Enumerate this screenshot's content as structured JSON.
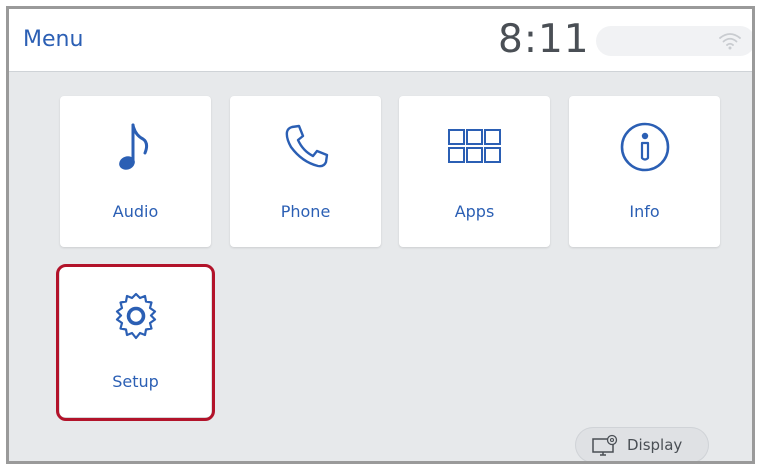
{
  "header": {
    "title": "Menu",
    "time": "8:11",
    "status_icon": "wifi-icon"
  },
  "tiles": [
    {
      "label": "Audio",
      "icon": "music-note-icon"
    },
    {
      "label": "Phone",
      "icon": "phone-icon"
    },
    {
      "label": "Apps",
      "icon": "apps-grid-icon"
    },
    {
      "label": "Info",
      "icon": "info-icon"
    },
    {
      "label": "Setup",
      "icon": "gear-icon",
      "selected": true
    }
  ],
  "footer": {
    "display_label": "Display",
    "display_icon": "display-settings-icon"
  },
  "colors": {
    "accent": "#2b5fb4",
    "highlight": "#b2132a",
    "background": "#e7e9eb"
  }
}
